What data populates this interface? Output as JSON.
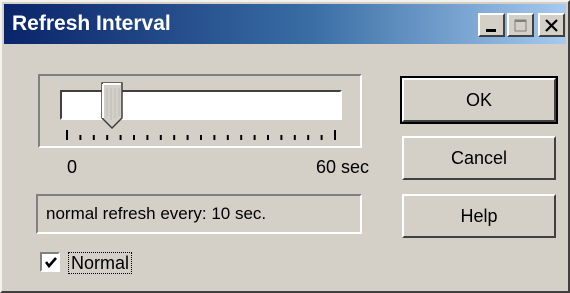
{
  "window": {
    "title": "Refresh Interval"
  },
  "slider": {
    "min_label": "0",
    "max_label": "60 sec",
    "value_seconds": 10,
    "range_seconds": [
      0,
      60
    ]
  },
  "status": {
    "text": "normal refresh every:  10 sec."
  },
  "checkbox": {
    "label": "Normal",
    "checked": true
  },
  "buttons": {
    "ok": "OK",
    "cancel": "Cancel",
    "help": "Help"
  },
  "icons": {
    "minimize": "minimize-icon",
    "maximize": "maximize-icon",
    "close": "close-icon",
    "check": "checkmark-icon"
  },
  "colors": {
    "title_gradient_start": "#0a246a",
    "title_gradient_end": "#a6caf0",
    "face": "#d4d0c8"
  }
}
